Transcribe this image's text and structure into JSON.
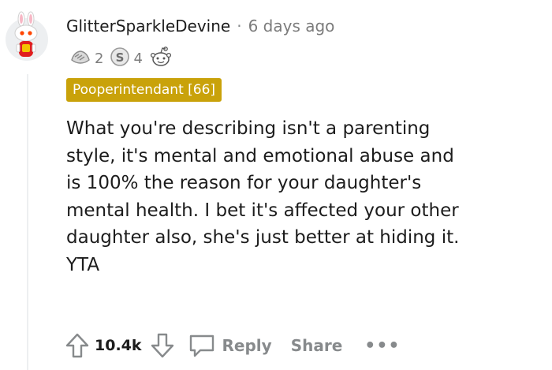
{
  "comment": {
    "username": "GlitterSparkleDevine",
    "separator": "·",
    "timestamp": "6 days ago",
    "awards": [
      {
        "icon": "helpful-hands-award-icon",
        "count": "2"
      },
      {
        "icon": "silver-award-icon",
        "count": "4"
      },
      {
        "icon": "wholesome-snoo-award-icon",
        "count": ""
      }
    ],
    "flair": "Pooperintendant [66]",
    "body": [
      "What you're describing isn't a parenting",
      "style, it's mental and emotional abuse and",
      "is 100% the reason for your daughter's",
      "mental health. I bet it's affected your other",
      "daughter also, she's just better at hiding it.",
      "YTA"
    ],
    "score": "10.4k",
    "actions": {
      "reply": "Reply",
      "share": "Share",
      "more": "•••"
    }
  },
  "colors": {
    "flair_bg": "#c9a20a",
    "muted": "#878a8c",
    "text": "#1c1c1c"
  }
}
